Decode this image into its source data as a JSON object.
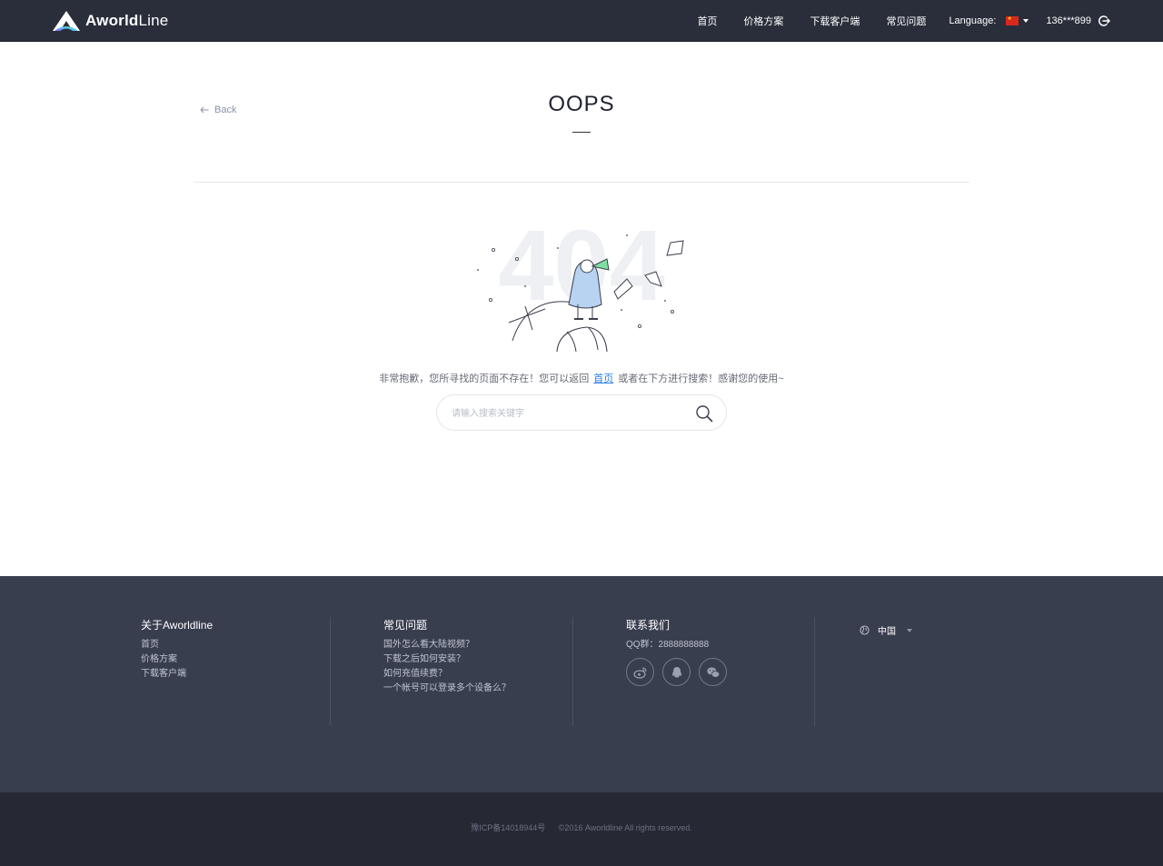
{
  "header": {
    "brand_bold": "Aworld",
    "brand_light": "Line",
    "nav": [
      "首页",
      "价格方案",
      "下载客户端",
      "常见问题"
    ],
    "language_label": "Language:",
    "user": "136***899"
  },
  "page": {
    "back_label": "Back",
    "title": "OOPS",
    "illustration_text": "404",
    "message_before": "非常抱歉，您所寻找的页面不存在！您可以返回",
    "message_link": "首页",
    "message_after": "或者在下方进行搜索！感谢您的使用~",
    "search_placeholder": "请输入搜索关键字"
  },
  "footer": {
    "about": {
      "title": "关于Aworldline",
      "links": [
        "首页",
        "价格方案",
        "下载客户端"
      ]
    },
    "faq": {
      "title": "常见问题",
      "links": [
        "国外怎么看大陆视频？",
        "下载之后如何安装？",
        "如何充值续费？",
        "一个帐号可以登录多个设备么？"
      ]
    },
    "contact": {
      "title": "联系我们",
      "qq": "QQ群：2888888888"
    },
    "region": "中国",
    "icp": "豫ICP备14018944号",
    "copyright": "©2016 Aworldline All rights reserved."
  },
  "colors": {
    "header_bg": "#2a2e3b",
    "footer_bg": "#393e4f",
    "bottom_bg": "#262934",
    "link": "#2d7ee0"
  }
}
